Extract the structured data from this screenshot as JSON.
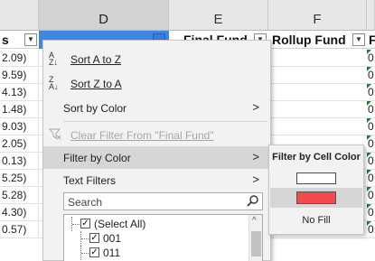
{
  "columns": {
    "c": "",
    "d": "D",
    "e": "E",
    "f": "F"
  },
  "headers": {
    "c": "s",
    "e": "Final Fund",
    "f": "Rollup Fund",
    "g": "F"
  },
  "filter_button_glyph": "▼",
  "c_values": [
    "2.09)",
    "9.59)",
    "4.13)",
    "1.48)",
    "9.03)",
    "2.05)",
    "0.13)",
    "5.25)",
    "5.28)",
    "4.30)",
    "0.57)"
  ],
  "g_values": [
    "0",
    "0",
    "0",
    "0",
    "0",
    "0",
    "0",
    "0",
    "0",
    "0",
    "0"
  ],
  "menu": {
    "sort_a_z": {
      "label": "Sort A to Z",
      "icon": "sort-ascending-icon"
    },
    "sort_z_a": {
      "label": "Sort Z to A",
      "icon": "sort-descending-icon"
    },
    "sort_by_color": {
      "label": "Sort by Color"
    },
    "clear_filter": {
      "label": "Clear Filter From \"Final Fund\"",
      "icon": "clear-filter-icon"
    },
    "filter_by_color": {
      "label": "Filter by Color"
    },
    "text_filters": {
      "label": "Text Filters"
    },
    "search_placeholder": "Search",
    "list": [
      {
        "label": "(Select All)",
        "checked": true
      },
      {
        "label": "001",
        "checked": true
      },
      {
        "label": "011",
        "checked": true
      }
    ]
  },
  "submenu": {
    "title": "Filter by Cell Color",
    "swatches": [
      "#ffffff",
      "#f24b4b"
    ],
    "no_fill": "No Fill"
  },
  "colors": {
    "selected_header": "#3f86e0",
    "highlight": "#d6d6d6",
    "error_triangle": "#1e7b3c"
  }
}
